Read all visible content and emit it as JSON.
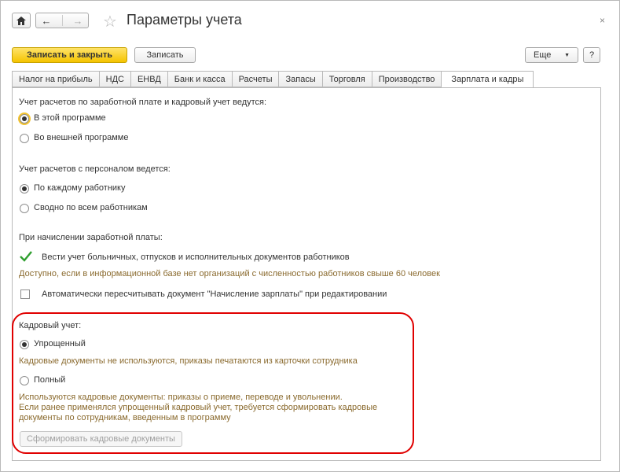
{
  "header": {
    "title": "Параметры учета",
    "close": "×"
  },
  "toolbar": {
    "save_close": "Записать и закрыть",
    "save": "Записать",
    "more": "Еще",
    "more_arrow": "▼",
    "help": "?"
  },
  "tabs": [
    {
      "label": "Налог на прибыль"
    },
    {
      "label": "НДС"
    },
    {
      "label": "ЕНВД"
    },
    {
      "label": "Банк и касса"
    },
    {
      "label": "Расчеты"
    },
    {
      "label": "Запасы"
    },
    {
      "label": "Торговля"
    },
    {
      "label": "Производство"
    },
    {
      "label": "Зарплата и кадры"
    }
  ],
  "section1": {
    "title": "Учет расчетов по заработной плате и кадровый учет ведутся:",
    "options": [
      "В этой программе",
      "Во внешней программе"
    ]
  },
  "section2": {
    "title": "Учет расчетов с персоналом ведется:",
    "options": [
      "По каждому работнику",
      "Сводно по всем работникам"
    ]
  },
  "section3": {
    "title": "При начислении заработной платы:",
    "check1": "Вести учет больничных, отпусков и исполнительных документов работников",
    "check1_hint": "Доступно, если в информационной базе нет организаций с численностью работников свыше 60 человек",
    "check2": "Автоматически пересчитывать документ \"Начисление зарплаты\" при редактировании"
  },
  "hr": {
    "title": "Кадровый учет:",
    "simple": "Упрощенный",
    "simple_hint": "Кадровые документы не используются, приказы печатаются из карточки сотрудника",
    "full": "Полный",
    "full_hint1": "Используются кадровые документы: приказы о приеме, переводе и увольнении.",
    "full_hint2": "Если ранее применялся упрощенный кадровый учет, требуется сформировать кадровые",
    "full_hint3": "документы по сотрудникам, введенным в программу",
    "generate_button": "Сформировать кадровые документы"
  },
  "colors": {
    "primary_button": "#f5c400",
    "hint_text": "#8a6a2e",
    "highlight_frame": "#e00000"
  }
}
